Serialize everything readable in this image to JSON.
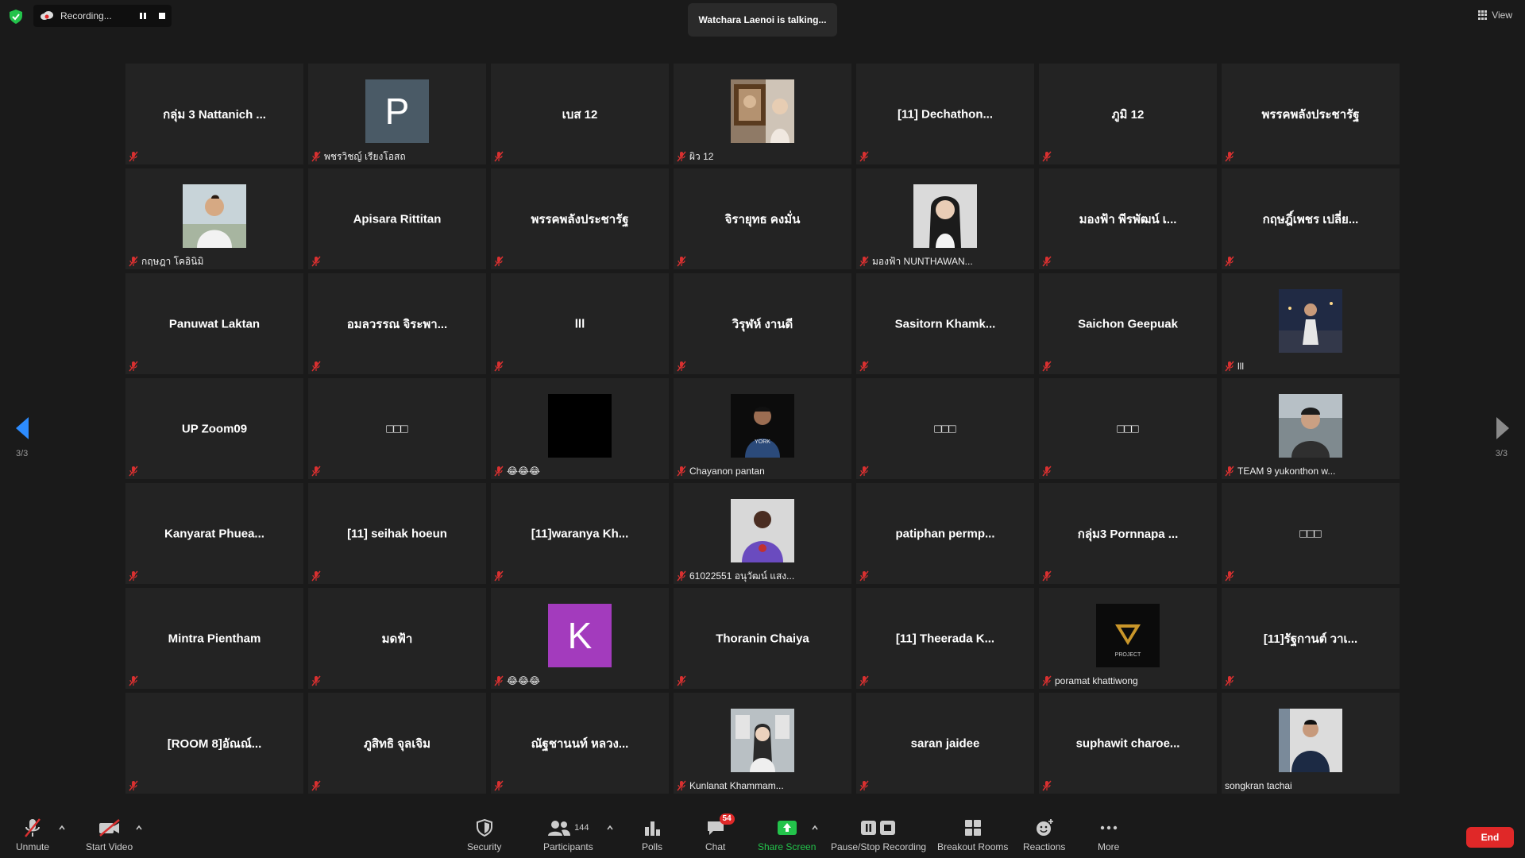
{
  "topbar": {
    "recording_label": "Recording...",
    "talking_text": "Watchara Laenoi is talking...",
    "view_label": "View"
  },
  "pagination": {
    "left": "3/3",
    "right": "3/3"
  },
  "tiles": [
    {
      "name": "กลุ่ม 3 Nattanich ...",
      "footer": ""
    },
    {
      "letter": "P",
      "avatar_color": "#4a5a66",
      "footer": "พชรวิชญ์ เรียงโอสถ"
    },
    {
      "name": "เบส 12",
      "footer": ""
    },
    {
      "photo": "painting",
      "footer": "ผิว 12"
    },
    {
      "name": "[11]  Dechathon...",
      "footer": ""
    },
    {
      "name": "ภูมิ 12",
      "footer": ""
    },
    {
      "name": "พรรคพลังประชารัฐ",
      "footer": ""
    },
    {
      "photo": "boy-white-shirt",
      "footer": "กฤษฎา โคอินิมิ"
    },
    {
      "name": "Apisara Rittitan",
      "footer": ""
    },
    {
      "name": "พรรคพลังประชารัฐ",
      "footer": ""
    },
    {
      "name": "จิรายุทธ คงมั่น",
      "footer": ""
    },
    {
      "photo": "girl-portrait",
      "footer": "มองฟ้า NUNTHAWAN..."
    },
    {
      "name": "มองฟ้า พีรพัฒน์ เ...",
      "footer": ""
    },
    {
      "name": "กฤษฎิ์เพชร เปลี่ย...",
      "footer": ""
    },
    {
      "name": "Panuwat Laktan",
      "footer": ""
    },
    {
      "name": "อมลวรรณ จิระพา...",
      "footer": ""
    },
    {
      "name": "lll",
      "footer": ""
    },
    {
      "name": "วิรุฬห์ งานดี",
      "footer": ""
    },
    {
      "name": "Sasitorn  Khamk...",
      "footer": ""
    },
    {
      "name": "Saichon Geepuak",
      "footer": ""
    },
    {
      "photo": "night-boy",
      "footer": "lll"
    },
    {
      "name": "UP Zoom09",
      "footer": ""
    },
    {
      "name": "□□□",
      "footer": ""
    },
    {
      "photo": "black",
      "footer": "😂😂😂"
    },
    {
      "photo": "boy-dark",
      "footer": "Chayanon pantan"
    },
    {
      "name": "□□□",
      "footer": ""
    },
    {
      "name": "□□□",
      "footer": ""
    },
    {
      "photo": "boy-outdoor",
      "footer": "TEAM 9 yukonthon w..."
    },
    {
      "name": "Kanyarat  Phuea...",
      "footer": ""
    },
    {
      "name": "[11] seihak hoeun",
      "footer": ""
    },
    {
      "name": "[11]waranya  Kh...",
      "footer": ""
    },
    {
      "photo": "purple-hoodie",
      "footer": "61022551 อนุวัฒน์ แสง..."
    },
    {
      "name": "patiphan  permp...",
      "footer": ""
    },
    {
      "name": "กลุ่ม3 Pornnapa ...",
      "footer": ""
    },
    {
      "name": "□□□",
      "footer": ""
    },
    {
      "name": "Mintra Pientham",
      "footer": ""
    },
    {
      "name": "มดฟ้า",
      "footer": ""
    },
    {
      "letter": "K",
      "avatar_color": "#a33bbd",
      "footer": "😂😂😂"
    },
    {
      "name": "Thoranin Chaiya",
      "footer": ""
    },
    {
      "name": "[11]  Theerada K...",
      "footer": ""
    },
    {
      "photo": "project-logo",
      "footer": "poramat khattiwong"
    },
    {
      "name": "[11]รัฐกานต์ วาเ...",
      "footer": ""
    },
    {
      "name": "[ROOM 8]อัณณ์...",
      "footer": ""
    },
    {
      "name": "ภูสิทธิ จุลเจิม",
      "footer": ""
    },
    {
      "name": "ณัฐชานนท์ หลวง...",
      "footer": ""
    },
    {
      "photo": "girl-gallery",
      "footer": "Kunlanat Khammam..."
    },
    {
      "name": "saran jaidee",
      "footer": ""
    },
    {
      "name": "suphawit  charoe...",
      "footer": ""
    },
    {
      "photo": "boy-navy",
      "footer": "songkran tachai",
      "unmuted": true
    }
  ],
  "toolbar": {
    "unmute": "Unmute",
    "start_video": "Start Video",
    "security": "Security",
    "participants": "Participants",
    "participants_count": "144",
    "polls": "Polls",
    "chat": "Chat",
    "chat_badge": "54",
    "share_screen": "Share Screen",
    "pause_stop": "Pause/Stop Recording",
    "breakout": "Breakout Rooms",
    "reactions": "Reactions",
    "more": "More",
    "end": "End"
  },
  "colors": {
    "accent_green": "#23c34b",
    "end_red": "#e02828",
    "muted_mic_red": "#d93030",
    "page_arrow_blue": "#2d8cff"
  }
}
